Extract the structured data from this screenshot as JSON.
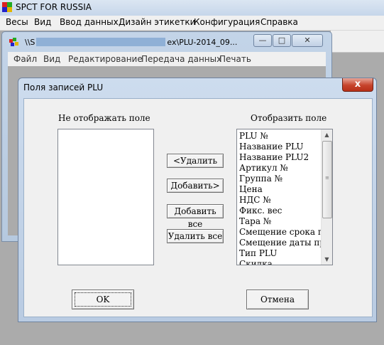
{
  "app": {
    "title": "SPCT FOR RUSSIA",
    "menu": [
      "Весы",
      "Вид",
      "Ввод данных",
      "Дизайн этикетки",
      "Конфигурация",
      "Справка"
    ]
  },
  "child_window": {
    "title_prefix": "\\\\S",
    "title_suffix": "ex\\PLU-2014_09...",
    "menu": [
      "Файл",
      "Вид",
      "Редактирование",
      "Передача данных",
      "Печать"
    ],
    "controls": {
      "minimize": "—",
      "maximize": "□",
      "close": "✕"
    }
  },
  "dialog": {
    "title": "Поля записей PLU",
    "close_label": "x",
    "hidden_label": "Не отображать поле",
    "shown_label": "Отобразить поле",
    "hidden_fields": [],
    "shown_fields": [
      "PLU №",
      "Название PLU",
      "Название PLU2",
      "Артикул №",
      "Группа №",
      "Цена",
      "НДС №",
      "Фикс. вес",
      "Тара №",
      "Смещение срока годности",
      "Смещение даты производства",
      "Тип PLU",
      "Скидка"
    ],
    "buttons": {
      "remove": "<Удалить",
      "add": "Добавить>",
      "add_all": "Добавить все",
      "remove_all": "Удалить все",
      "ok": "OK",
      "cancel": "Отмена"
    }
  },
  "colors": {
    "close_button": "#c6432b",
    "title_bar": "#c6d6ea",
    "workspace": "#ababab"
  }
}
